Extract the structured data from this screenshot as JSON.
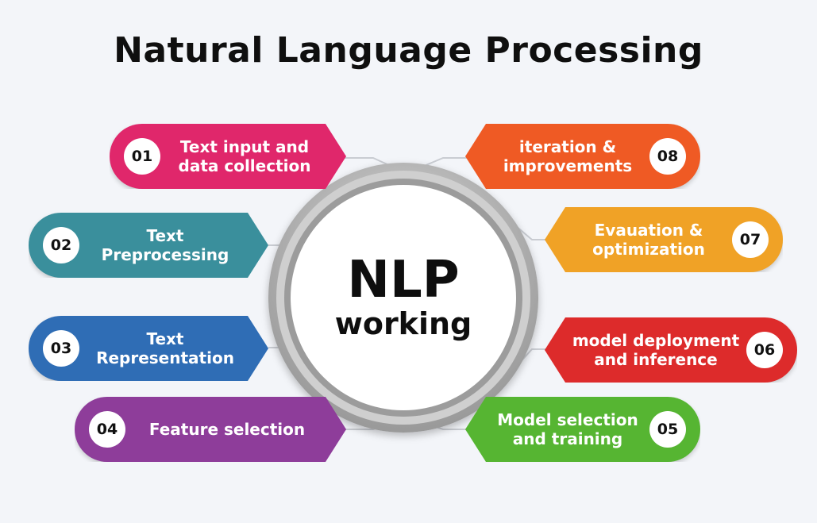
{
  "title": "Natural Language Processing",
  "center": {
    "line1": "NLP",
    "line2": "working"
  },
  "steps": [
    {
      "number": "01",
      "label": "Text input and\ndata collection",
      "color": "#e0276b"
    },
    {
      "number": "02",
      "label": "Text\nPreprocessing",
      "color": "#3a8f9c"
    },
    {
      "number": "03",
      "label": "Text\nRepresentation",
      "color": "#2f6db5"
    },
    {
      "number": "04",
      "label": "Feature selection",
      "color": "#8e3d9a"
    },
    {
      "number": "05",
      "label": "Model selection\nand training",
      "color": "#56b532"
    },
    {
      "number": "06",
      "label": "model deployment\nand inference",
      "color": "#dd2b2b"
    },
    {
      "number": "07",
      "label": "Evauation &\noptimization",
      "color": "#f0a226"
    },
    {
      "number": "08",
      "label": "iteration &\nimprovements",
      "color": "#ef5a24"
    }
  ]
}
